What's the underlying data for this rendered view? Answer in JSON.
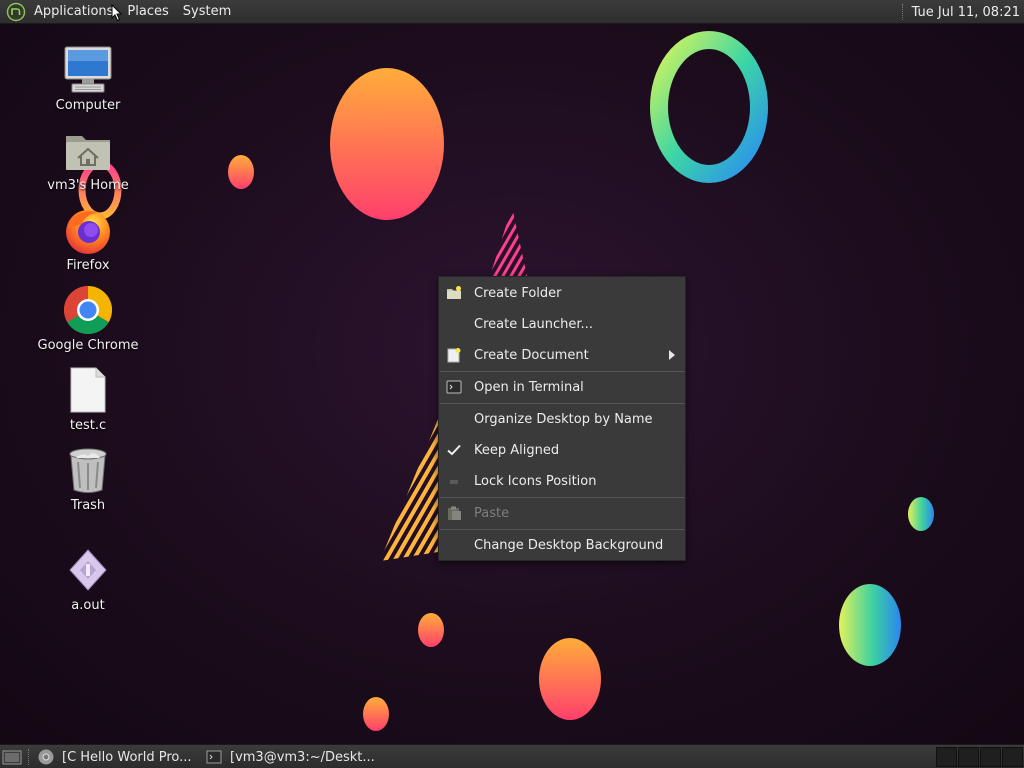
{
  "top_panel": {
    "menus": [
      "Applications",
      "Places",
      "System"
    ],
    "clock": "Tue Jul 11, 08:21"
  },
  "desktop_icons": [
    {
      "label": "Computer",
      "icon": "computer-icon"
    },
    {
      "label": "vm3's Home",
      "icon": "home-folder-icon"
    },
    {
      "label": "Firefox",
      "icon": "firefox-icon"
    },
    {
      "label": "Google Chrome",
      "icon": "chrome-icon"
    },
    {
      "label": "test.c",
      "icon": "text-file-icon"
    },
    {
      "label": "Trash",
      "icon": "trash-icon"
    },
    {
      "label": "a.out",
      "icon": "executable-icon"
    }
  ],
  "context_menu": {
    "items": [
      {
        "label": "Create Folder",
        "icon": "new-folder-icon",
        "enabled": true
      },
      {
        "label": "Create Launcher...",
        "icon": "",
        "enabled": true
      },
      {
        "label": "Create Document",
        "icon": "new-document-icon",
        "enabled": true,
        "submenu": true
      },
      {
        "label": "Open in Terminal",
        "icon": "terminal-icon",
        "enabled": true
      },
      {
        "label": "Organize Desktop by Name",
        "icon": "",
        "enabled": true
      },
      {
        "label": "Keep Aligned",
        "icon": "checkmark-icon",
        "enabled": true,
        "checked": true
      },
      {
        "label": "Lock Icons Position",
        "icon": "unchecked-box-icon",
        "enabled": true,
        "checked": false
      },
      {
        "label": "Paste",
        "icon": "paste-icon",
        "enabled": false
      },
      {
        "label": "Change Desktop Background",
        "icon": "",
        "enabled": true
      }
    ]
  },
  "taskbar": {
    "tasks": [
      {
        "label": "[C Hello World Pro...",
        "icon": "chrome-icon"
      },
      {
        "label": "[vm3@vm3:~/Deskt...",
        "icon": "terminal-icon"
      }
    ],
    "workspace_count": 4
  },
  "colors": {
    "panel_bg": "#333333",
    "menu_bg": "#3a3a3a",
    "desktop_bg": "#1d0f1e"
  }
}
